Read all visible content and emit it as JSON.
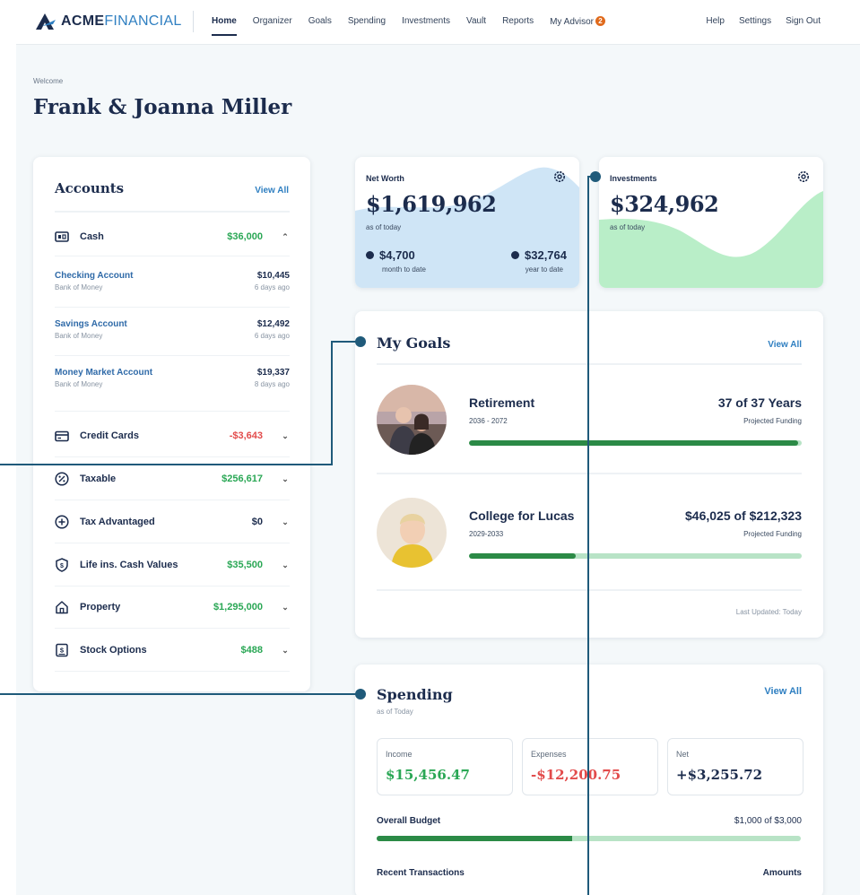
{
  "brand": {
    "name_bold": "ACME",
    "name_light": "FINANCIAL"
  },
  "nav": [
    "Home",
    "Organizer",
    "Goals",
    "Spending",
    "Investments",
    "Vault",
    "Reports",
    "My Advisor"
  ],
  "nav_badge": "2",
  "util_links": [
    "Help",
    "Settings",
    "Sign Out"
  ],
  "welcome": "Welcome",
  "user_name": "Frank & Joanna Miller",
  "accounts": {
    "title": "Accounts",
    "view_all": "View All",
    "cash": {
      "label": "Cash",
      "amount": "$36,000",
      "icon": "cash-icon"
    },
    "sub_accounts": [
      {
        "name": "Checking Account",
        "bank": "Bank of Money",
        "value": "$10,445",
        "time": "6 days ago"
      },
      {
        "name": "Savings Account",
        "bank": "Bank of Money",
        "value": "$12,492",
        "time": "6 days ago"
      },
      {
        "name": "Money Market Account",
        "bank": "Bank of Money",
        "value": "$19,337",
        "time": "8 days ago"
      }
    ],
    "categories": [
      {
        "label": "Credit Cards",
        "amount": "-$3,643",
        "tone": "red",
        "icon": "credit-card-icon"
      },
      {
        "label": "Taxable",
        "amount": "$256,617",
        "tone": "green",
        "icon": "percent-icon"
      },
      {
        "label": "Tax Advantaged",
        "amount": "$0",
        "tone": "dark",
        "icon": "plus-circle-icon"
      },
      {
        "label": "Life ins. Cash Values",
        "amount": "$35,500",
        "tone": "green",
        "icon": "shield-dollar-icon"
      },
      {
        "label": "Property",
        "amount": "$1,295,000",
        "tone": "green",
        "icon": "house-icon"
      },
      {
        "label": "Stock Options",
        "amount": "$488",
        "tone": "green",
        "icon": "stock-doc-icon"
      }
    ]
  },
  "net_worth": {
    "label": "Net Worth",
    "value": "$1,619,962",
    "as_of": "as of today",
    "mtd_value": "$4,700",
    "mtd_label": "month to date",
    "ytd_value": "$32,764",
    "ytd_label": "year to date",
    "color": "#cfe5f6"
  },
  "investments": {
    "label": "Investments",
    "value": "$324,962",
    "as_of": "as of today",
    "color": "#b9eec8"
  },
  "goals": {
    "title": "My Goals",
    "view_all": "View All",
    "items": [
      {
        "name": "Retirement",
        "years": "2036 - 2072",
        "amount": "37 of 37 Years",
        "funding": "Projected Funding",
        "progress": 0.99
      },
      {
        "name": "College for Lucas",
        "years": "2029-2033",
        "amount": "$46,025 of $212,323",
        "funding": "Projected Funding",
        "progress": 0.32
      }
    ],
    "last_updated": "Last Updated: Today"
  },
  "spending": {
    "title": "Spending",
    "as_of": "as of Today",
    "view_all": "View All",
    "income_label": "Income",
    "income": "$15,456.47",
    "expenses_label": "Expenses",
    "expenses": "-$12,200.75",
    "net_label": "Net",
    "net": "+$3,255.72",
    "budget_label": "Overall Budget",
    "budget_value": "$1,000 of $3,000",
    "budget_progress": 0.46,
    "recent_label": "Recent Transactions",
    "amounts_label": "Amounts"
  },
  "colors": {
    "accent": "#2f7fc1",
    "navy": "#1c2c4d",
    "green": "#2aa755",
    "red": "#e24b4b",
    "callout": "#1f5a7a"
  }
}
